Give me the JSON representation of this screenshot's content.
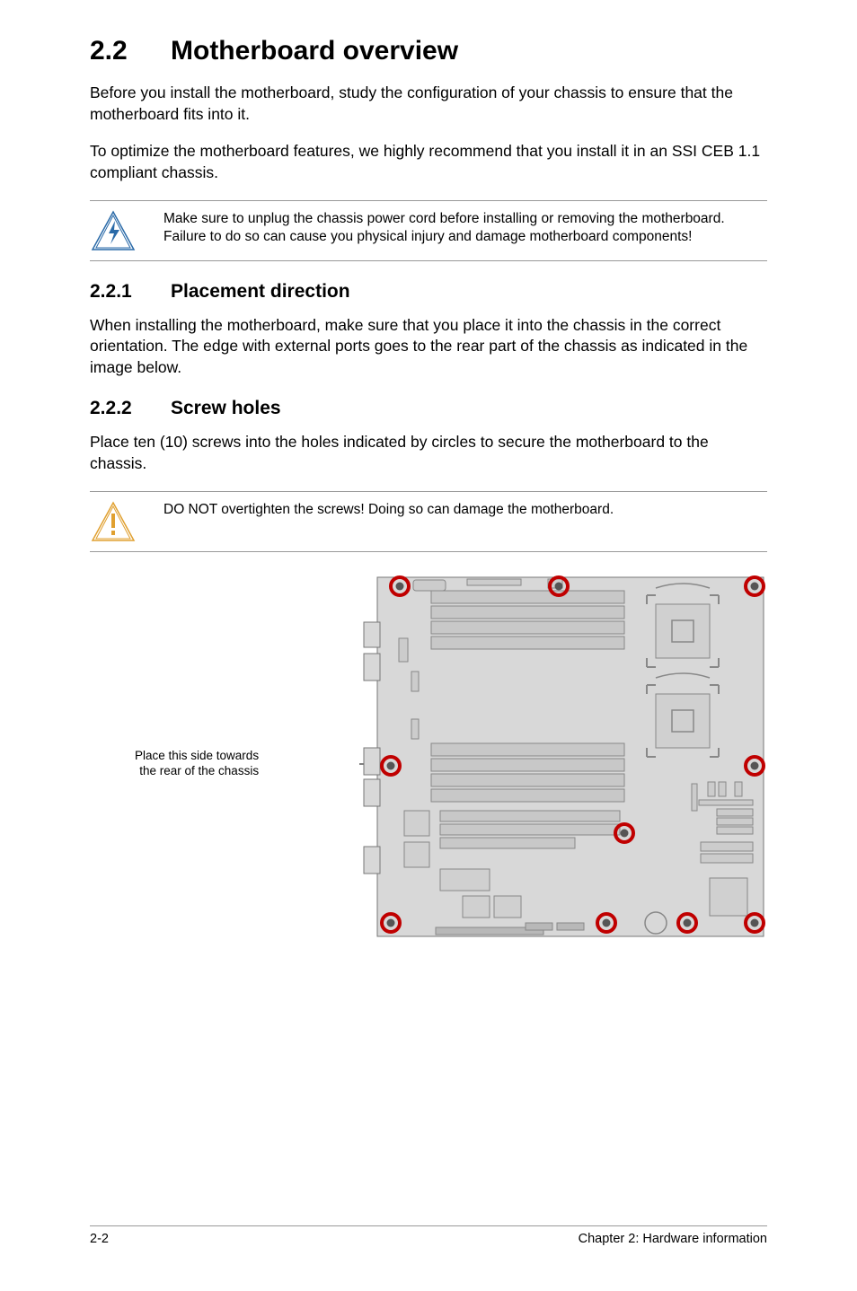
{
  "section": {
    "number": "2.2",
    "title": "Motherboard overview",
    "para1": "Before you install the motherboard, study the configuration of your chassis to ensure that the motherboard fits into it.",
    "para2": "To optimize the motherboard features, we highly recommend that you install it in an SSI CEB 1.1 compliant chassis."
  },
  "warning1": {
    "text": "Make sure to unplug the chassis power cord before installing or removing the motherboard. Failure to do so can cause you physical injury and damage motherboard components!"
  },
  "sub1": {
    "number": "2.2.1",
    "title": "Placement direction",
    "para": "When installing the motherboard, make sure that you place it into the chassis in the correct orientation. The edge with external ports goes to the rear part of the chassis as indicated in the image below."
  },
  "sub2": {
    "number": "2.2.2",
    "title": "Screw holes",
    "para": "Place ten (10) screws into the holes indicated by circles to secure the motherboard to the chassis."
  },
  "caution1": {
    "text": "DO NOT overtighten the screws! Doing so can damage the motherboard."
  },
  "diagram": {
    "side_label_line1": "Place this side towards",
    "side_label_line2": "the rear of the chassis"
  },
  "footer": {
    "page_num": "2-2",
    "chapter": "Chapter 2: Hardware information"
  }
}
